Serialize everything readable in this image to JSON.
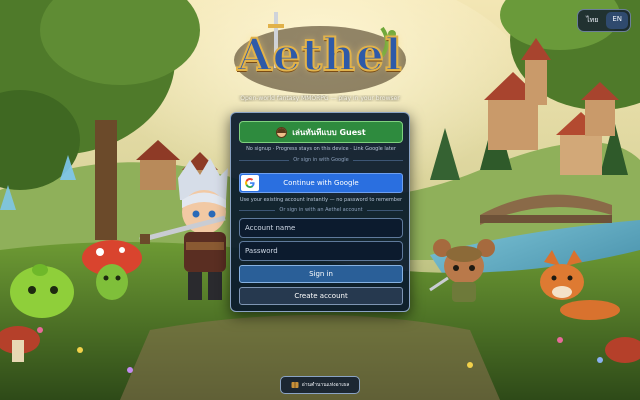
{
  "language_switch": {
    "options": [
      "ไทย",
      "EN"
    ],
    "active": "EN"
  },
  "logo": {
    "text": "Aethel"
  },
  "tagline": "Open-world fantasy MMORPG — play in your browser",
  "login": {
    "guest_button": "เล่นทันทีแบบ Guest",
    "guest_note": "No signup · Progress stays on this device · Link Google later",
    "or_google": "Or sign in with Google",
    "google_button": "Continue with Google",
    "google_note": "Use your existing account instantly — no password to remember",
    "or_account": "Or sign in with an Aethel account",
    "account_placeholder": "Account name",
    "password_placeholder": "Password",
    "signin_button": "Sign in",
    "create_button": "Create account"
  },
  "footer_link": "อ่านตำนานแห่งอาเธล",
  "colors": {
    "guest_green": "#2e8b3e",
    "google_blue": "#2a6fe0",
    "panel_bg": "#0a1a2c",
    "logo_blue": "#2e5aa8",
    "logo_gold": "#e1b24a"
  },
  "icons": [
    "guest-avatar-icon",
    "google-g-icon",
    "book-icon",
    "sword-icon"
  ]
}
